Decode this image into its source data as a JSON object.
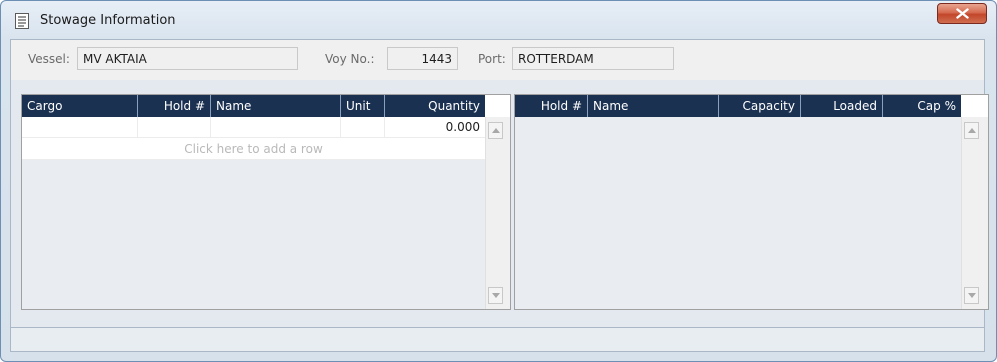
{
  "window": {
    "title": "Stowage Information"
  },
  "header": {
    "vessel_label": "Vessel:",
    "vessel_value": "MV AKTAIA",
    "voy_label": "Voy No.:",
    "voy_value": "1443",
    "port_label": "Port:",
    "port_value": "ROTTERDAM"
  },
  "cargo_grid": {
    "columns": [
      "Cargo",
      "Hold #",
      "Name",
      "Unit",
      "Quantity"
    ],
    "rows": [
      {
        "cargo": "",
        "hold": "",
        "name": "",
        "unit": "",
        "quantity": "0.000"
      }
    ],
    "add_row_text": "Click here to add a row"
  },
  "hold_grid": {
    "columns": [
      "Hold #",
      "Name",
      "Capacity",
      "Loaded",
      "Cap %"
    ],
    "rows": []
  },
  "colors": {
    "header_bg": "#1b3152",
    "close_button": "#c2462a",
    "grid_body": "#e9ecf1"
  },
  "icons": {
    "title": "stowage-list-icon",
    "close": "close-icon"
  }
}
